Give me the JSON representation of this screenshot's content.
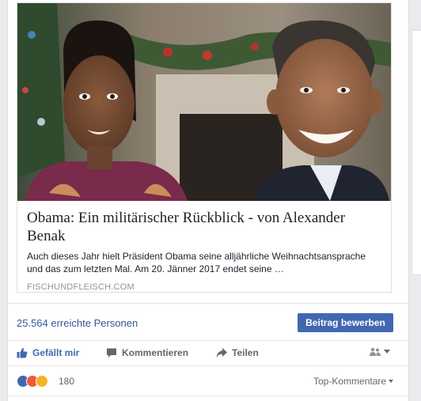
{
  "link_preview": {
    "title": "Obama: Ein militärischer Rückblick - von Alexander Benak",
    "description": "Auch dieses Jahr hielt Präsident Obama seine alljährliche Weihnachtsansprache und das zum letzten Mal. Am 20. Jänner 2017 endet seine …",
    "domain": "FISCHUNDFLEISCH.COM"
  },
  "reach": {
    "text": "25.564 erreichte Personen",
    "boost_label": "Beitrag bewerben"
  },
  "actions": {
    "like_label": "Gefällt mir",
    "comment_label": "Kommentieren",
    "share_label": "Teilen",
    "audience_icon": "friends-icon"
  },
  "reactions": {
    "icons": [
      "like",
      "angry",
      "sad"
    ],
    "count": "180",
    "sort_label": "Top-Kommentare"
  },
  "colors": {
    "link_blue": "#365899",
    "button_blue": "#4267b2",
    "like_blue": "#4267b2",
    "angry_red": "#f05a3c",
    "sad_yellow": "#f7b125"
  }
}
